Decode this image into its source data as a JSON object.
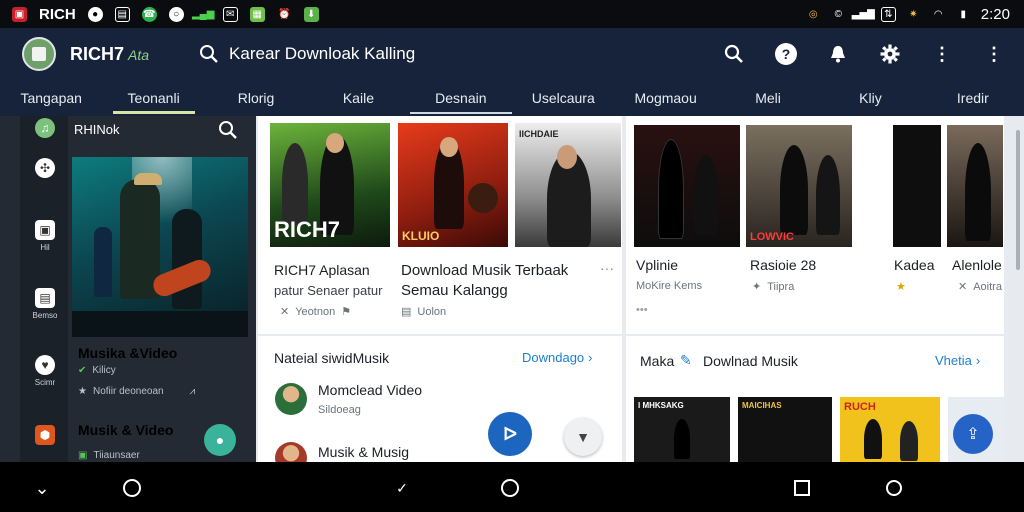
{
  "status": {
    "brand": "RICH",
    "time": "2:20"
  },
  "appbar": {
    "title": "RICH7",
    "title_sub": "Ata",
    "search_query": "Karear Downloak Kalling"
  },
  "tabs": [
    {
      "label": "Tangapan"
    },
    {
      "label": "Teonanli"
    },
    {
      "label": "Rlorig"
    },
    {
      "label": "Kaile"
    },
    {
      "label": "Desnain"
    },
    {
      "label": "Uselcaura"
    },
    {
      "label": "Mogmaou"
    },
    {
      "label": "Meli"
    },
    {
      "label": "Kliy"
    },
    {
      "label": "Iredir"
    }
  ],
  "sidebar": {
    "header": "RHINok",
    "rail_labels": [
      "Hil",
      "Bemso",
      "Scimr"
    ],
    "hero_title": "Musika &Video",
    "hero_line1": "Kilicy",
    "hero_line2": "Nofiir deoneoan",
    "item2_title": "Musik & Video",
    "item2_line": "Tiiaunsaer"
  },
  "thumbs_left": [
    {
      "caption": "RICH7"
    },
    {
      "caption": "KLUIO"
    },
    {
      "caption": "IICHDAIE"
    }
  ],
  "card1": {
    "title_a": "RICH7 Aplasan",
    "sub_a": "patur Senaer patur",
    "meta_a": "Yeotnon",
    "title_b": "Download Musik Terbaak",
    "sub_b": "Semau Kalangg",
    "meta_b": "Uolon"
  },
  "thumbs_right": [
    {
      "caption": ""
    },
    {
      "caption": "LOWVIC"
    },
    {
      "caption": ""
    },
    {
      "caption": ""
    }
  ],
  "card2": {
    "items": [
      {
        "title": "Vplinie",
        "meta": "MoKire Kems"
      },
      {
        "title": "Rasioie 28",
        "meta": "Tiipra"
      },
      {
        "title": "Kadea",
        "meta": ""
      },
      {
        "title": "Alenlole",
        "meta": "Aoitra"
      }
    ]
  },
  "section_left": {
    "title": "Nateial siwidMusik",
    "link": "Downdago",
    "rows": [
      {
        "title": "Momclead Video",
        "sub": "Sildoeag"
      },
      {
        "title": "Musik & Musig",
        "sub": ""
      }
    ]
  },
  "section_right": {
    "title_a": "Maka",
    "title_b": "Dowlnad Musik",
    "link": "Vhetia",
    "thumbs": [
      {
        "caption": "I MHKSAKG"
      },
      {
        "caption": "MAICIHAS"
      },
      {
        "caption": "RUCH"
      },
      {
        "caption": ""
      }
    ]
  },
  "colors": {
    "appbar": "#17233a",
    "accent_blue": "#1b7fd6",
    "link": "#1b7fd6",
    "tab_indicator": "#d8e5a0"
  }
}
